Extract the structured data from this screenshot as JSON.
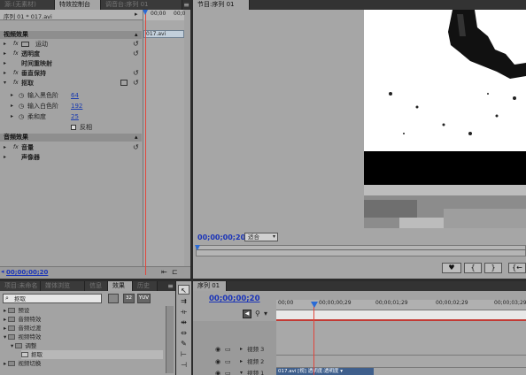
{
  "top_tabs": {
    "source": "源:(无素材)",
    "effect_controls": "特效控制台",
    "mixer": "调音台:序列 01",
    "program": "节目:序列 01"
  },
  "effect_controls": {
    "sequence_clip": "序列 01 * 017.avi",
    "ruler_start": "00;00",
    "ruler_mark": "00;0",
    "clip_bar_label": "017.avi",
    "video_effects_header": "视频效果",
    "effects": [
      {
        "label": "运动"
      },
      {
        "label": "透明度"
      },
      {
        "label": "时间重映射"
      },
      {
        "label": "垂直保持"
      },
      {
        "label": "抠取"
      }
    ],
    "params": [
      {
        "label": "输入黑色阶",
        "value": "64"
      },
      {
        "label": "输入白色阶",
        "value": "192"
      },
      {
        "label": "柔和度",
        "value": "25"
      }
    ],
    "invert_label": "反相",
    "audio_effects_header": "音频效果",
    "audio_effects": [
      {
        "label": "音量"
      },
      {
        "label": "声像器"
      }
    ],
    "timecode": "00;00;00;20"
  },
  "program": {
    "timecode": "00;00;00;20",
    "fit_select": "适合"
  },
  "project_panel": {
    "tabs": [
      "项目:未命名",
      "媒体浏览",
      "信息",
      "效果",
      "历史"
    ],
    "search_value": "抠取",
    "badges": [
      "32",
      "YUV"
    ],
    "items": [
      {
        "label": "预设"
      },
      {
        "label": "音频特效"
      },
      {
        "label": "音频过渡"
      },
      {
        "label": "视频特效"
      },
      {
        "label": "调整"
      },
      {
        "label": "抠取"
      },
      {
        "label": "视频切换"
      }
    ]
  },
  "timeline": {
    "tab": "序列 01",
    "timecode": "00;00;00;20",
    "ruler": [
      "00;00",
      "00;00;00;29",
      "00;00;01;29",
      "00;00;02;29",
      "00;00;03;29"
    ],
    "tracks": [
      "视频 3",
      "视频 2",
      "视频 1"
    ],
    "clip_label": "017.avi [视] 透明度:透明度 ▾"
  }
}
